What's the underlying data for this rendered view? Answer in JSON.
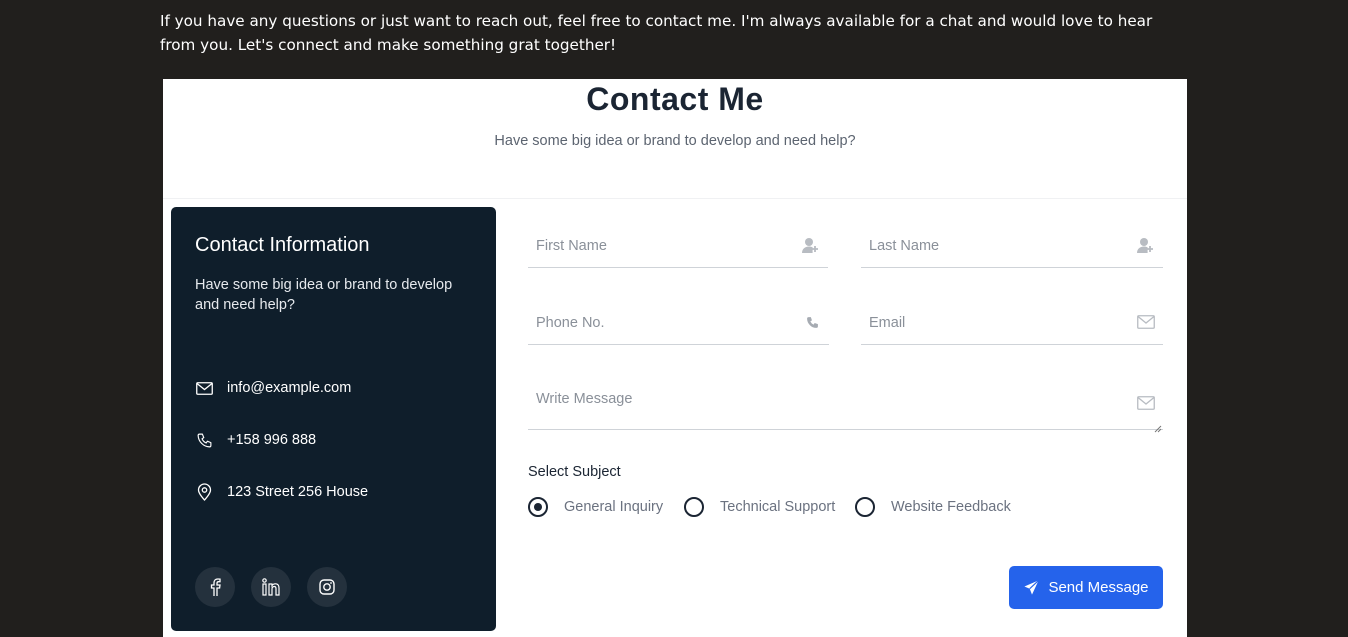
{
  "intro_text": "If you have any questions or just want to reach out, feel free to contact me. I'm always available for a chat and would love to hear from you. Let's connect and make something grat together!",
  "header": {
    "title": "Contact Me",
    "subtitle": "Have some big idea or brand to develop and need help?"
  },
  "contact_info": {
    "title": "Contact Information",
    "description": "Have some big idea or brand to develop and need help?",
    "email": "info@example.com",
    "phone": "+158 996 888",
    "address": "123 Street 256 House",
    "socials": [
      "facebook-icon",
      "linkedin-icon",
      "instagram-icon"
    ]
  },
  "form": {
    "first_name_placeholder": "First Name",
    "last_name_placeholder": "Last Name",
    "phone_placeholder": "Phone No.",
    "email_placeholder": "Email",
    "message_placeholder": "Write Message",
    "subject_label": "Select Subject",
    "subjects": [
      {
        "label": "General Inquiry",
        "selected": true
      },
      {
        "label": "Technical Support",
        "selected": false
      },
      {
        "label": "Website Feedback",
        "selected": false
      }
    ],
    "send_label": "Send Message"
  },
  "colors": {
    "page_background": "#211f1d",
    "info_panel": "#0f1e2b",
    "accent_button": "#2563eb"
  }
}
